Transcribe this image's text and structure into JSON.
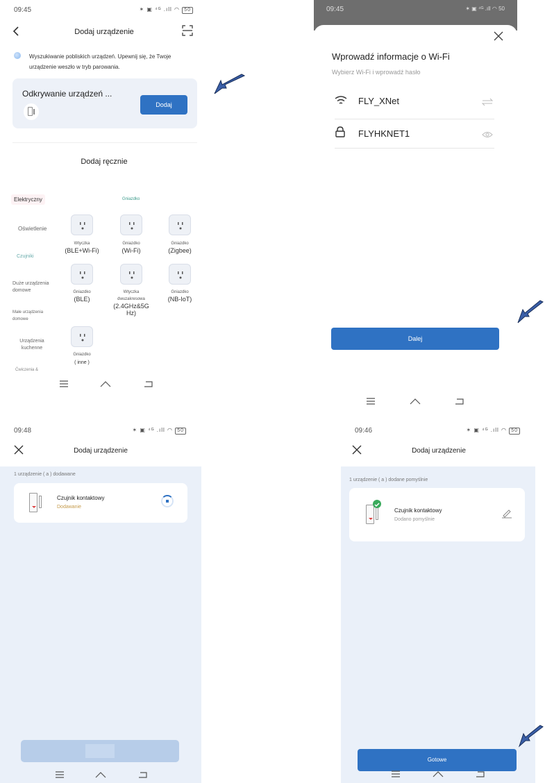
{
  "panel1": {
    "time": "09:45",
    "status_icons": "✶ ▣ ⁴ᴳ .ıll ◠ ",
    "battery": "50",
    "title": "Dodaj urządzenie",
    "search_text_1": "Wyszukiwanie pobliskich urządzeń. Upewnij się, że Twoje",
    "search_text_2": "urządzenie weszło w tryb parowania.",
    "discovering_label": "Odkrywanie urządzeń ...",
    "add_button": "Dodaj",
    "manual_label": "Dodaj ręcznie",
    "categories": [
      "Elektryczny",
      "Oświetlenie",
      "Czujniki",
      "Duże urządzenia domowe",
      "Małe urządzenia domowe",
      "Urządzenia kuchenne",
      "Ćwiczenia &"
    ],
    "section_label": "Gniazdko",
    "devices": [
      {
        "line1": "Wtyczka",
        "line2": "(BLE+Wi-Fi)"
      },
      {
        "line1": "Gniazdko",
        "line2": "(Wi-Fi)"
      },
      {
        "line1": "Gniazdko",
        "line2": "(Zigbee)"
      },
      {
        "line1": "Gniazdko",
        "line2": "(BLE)"
      },
      {
        "line1": "Wtyczka dwuzakresowa",
        "line2": "(2.4GHz&5G Hz)"
      },
      {
        "line1": "Gniazdko",
        "line2": "(NB-IoT)"
      },
      {
        "line1": "Gniazdko",
        "line2": "( inne )"
      }
    ]
  },
  "panel2": {
    "time": "09:45",
    "status_icons": "✶ ▣ ⁴ᴳ .ıll ◠ ",
    "battery": "50",
    "title": "Wprowadź informacje o Wi-Fi",
    "subtitle": "Wybierz Wi-Fi i wprowadź hasło",
    "ssid": "FLY_XNet",
    "password": "FLYHKNET1",
    "next_button": "Dalej"
  },
  "panel3": {
    "time": "09:48",
    "status_icons": "✶ ▣ ⁴ᴳ .ıll ◠ ",
    "battery": "50",
    "title": "Dodaj urządzenie",
    "count_text": "1 urządzenie ( a ) dodawane",
    "device_name": "Czujnik kontaktowy",
    "device_status": "Dodawanie"
  },
  "panel4": {
    "time": "09:46",
    "status_icons": "✶ ▣ ⁴ᴳ .ıll ◠ ",
    "battery": "50",
    "title": "Dodaj urządzenie",
    "count_text": "1 urządzenie ( a ) dodane pomyślnie",
    "device_name": "Czujnik kontaktowy",
    "device_status": "Dodano pomyślnie",
    "done_button": "Gotowe"
  },
  "colors": {
    "primary": "#2f72c3",
    "arrow": "#3a5fa8",
    "card_bg": "#edf1f8",
    "screen_bg": "#eaf0f9"
  }
}
